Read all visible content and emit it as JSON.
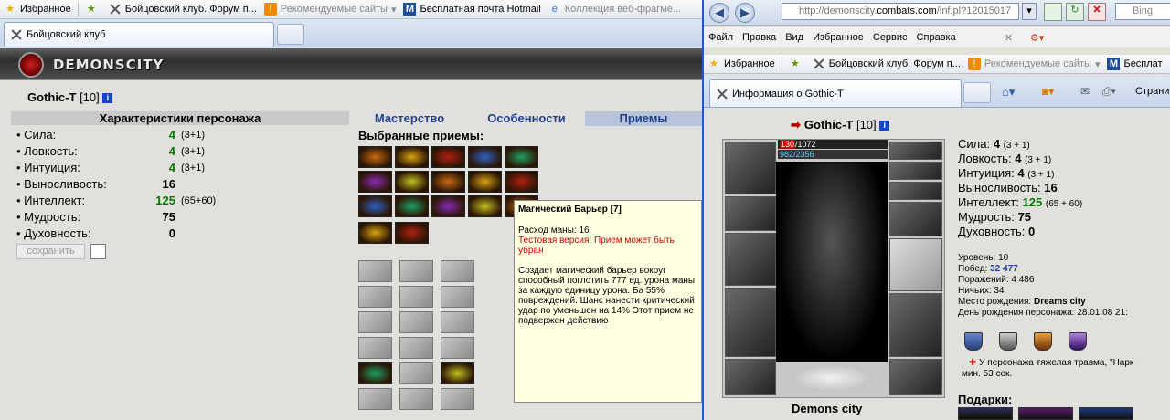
{
  "left": {
    "favbar": {
      "favorites": "Избранное",
      "item1": "Бойцовский клуб. Форум п...",
      "item2": "Рекомендуемые сайты",
      "item3": "Бесплатная почта Hotmail",
      "item4": "Коллекция веб-фрагме..."
    },
    "tab": "Бойцовский клуб",
    "logo": "DEMONSCITY",
    "char_name": "Gothic-T",
    "char_level": "[10]",
    "info_icon": "i",
    "stats_header": "Характеристики персонажа",
    "stats": [
      {
        "label": "• Сила:",
        "value": "4",
        "bonus": "(3+1)",
        "green": true
      },
      {
        "label": "• Ловкость:",
        "value": "4",
        "bonus": "(3+1)",
        "green": true
      },
      {
        "label": "• Интуиция:",
        "value": "4",
        "bonus": "(3+1)",
        "green": true
      },
      {
        "label": "• Выносливость:",
        "value": "16",
        "bonus": "",
        "green": false
      },
      {
        "label": "• Интеллект:",
        "value": "125",
        "bonus": "(65+60)",
        "green": true
      },
      {
        "label": "• Мудрость:",
        "value": "75",
        "bonus": "",
        "green": false
      },
      {
        "label": "• Духовность:",
        "value": "0",
        "bonus": "",
        "green": false
      }
    ],
    "save_button": "сохранить",
    "tabs": [
      "Мастерство",
      "Особенности",
      "Приемы"
    ],
    "selected_label": "Выбранные приемы:",
    "tooltip": {
      "title": "Магический Барьер [7]",
      "mana": "Расход маны: 16",
      "warning": "Тестовая версия! Прием может быть убран",
      "desc": "Создает магический барьер вокруг способный поглотить 777 ед. урона маны за каждую единицу урона. Ба 55% повреждений. Шанс нанести критический удар по уменьшен на 14% Этот прием не подвержен действию"
    }
  },
  "right": {
    "url_prefix": "http://demonscity.",
    "url_domain": "combats.com",
    "url_suffix": "/inf.pl?12015017",
    "search_placeholder": "Bing",
    "menu": [
      "Файл",
      "Правка",
      "Вид",
      "Избранное",
      "Сервис",
      "Справка"
    ],
    "favbar": {
      "favorites": "Избранное",
      "item1": "Бойцовский клуб. Форум п...",
      "item2": "Рекомендуемые сайты",
      "item3": "Бесплат"
    },
    "tab": "Информация о Gothic-T",
    "page_label": "Страни",
    "char_name": "Gothic-T",
    "char_level": "[10]",
    "hp_cur": "130",
    "hp_rest": "/1072",
    "mana": "982/2356",
    "stats": [
      {
        "label": "Сила:",
        "value": "4",
        "bonus": "(3 + 1)"
      },
      {
        "label": "Ловкость:",
        "value": "4",
        "bonus": "(3 + 1)"
      },
      {
        "label": "Интуиция:",
        "value": "4",
        "bonus": "(3 + 1)"
      },
      {
        "label": "Выносливость:",
        "value": "16",
        "bonus": ""
      },
      {
        "label": "Интеллект:",
        "value": "125",
        "bonus": "(65 + 60)"
      },
      {
        "label": "Мудрость:",
        "value": "75",
        "bonus": ""
      },
      {
        "label": "Духовность:",
        "value": "0",
        "bonus": ""
      }
    ],
    "level": "Уровень: 10",
    "wins_label": "Побед:",
    "wins": "32 477",
    "losses": "Поражений: 4 486",
    "draws": "Ничьих: 34",
    "birthplace_label": "Место рождения:",
    "birthplace": "Dreams city",
    "birthday": "День рождения персонажа: 28.01.08 21:",
    "trauma": "У персонажа тяжелая травма, \"Нарк",
    "trauma2": "мин. 53 сек.",
    "gifts": "Подарки:",
    "city": "Demons city"
  },
  "colors": {
    "accent": "#1f3f8c",
    "green": "#007a00",
    "red": "#c00000",
    "tooltip": "#ffffe1"
  }
}
